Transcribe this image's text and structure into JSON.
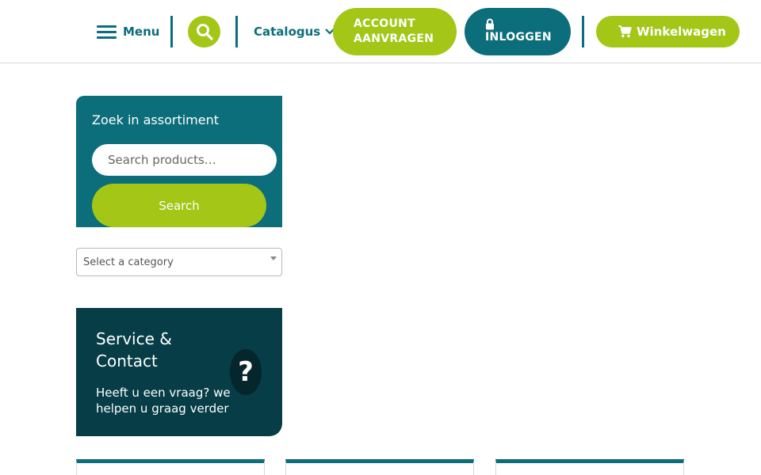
{
  "header": {
    "menu_label": "Menu",
    "catalogus_label": "Catalogus",
    "account_label": "ACCOUNT\nAANVRAGEN",
    "login_label": "INLOGGEN",
    "cart_label": "Winkelwagen"
  },
  "search_panel": {
    "title": "Zoek in assortiment",
    "placeholder": "Search products…",
    "button_label": "Search"
  },
  "category": {
    "selected": "Select a category"
  },
  "service": {
    "title": "Service & Contact",
    "text": "Heeft u een vraag? we helpen u graag verder",
    "icon_glyph": "?"
  },
  "colors": {
    "primary": "#0b6e7a",
    "accent": "#a3c617",
    "dark": "#063d46"
  },
  "icons": [
    "hamburger-icon",
    "search-icon",
    "chevron-down-icon",
    "lock-icon",
    "cart-icon",
    "question-icon"
  ]
}
